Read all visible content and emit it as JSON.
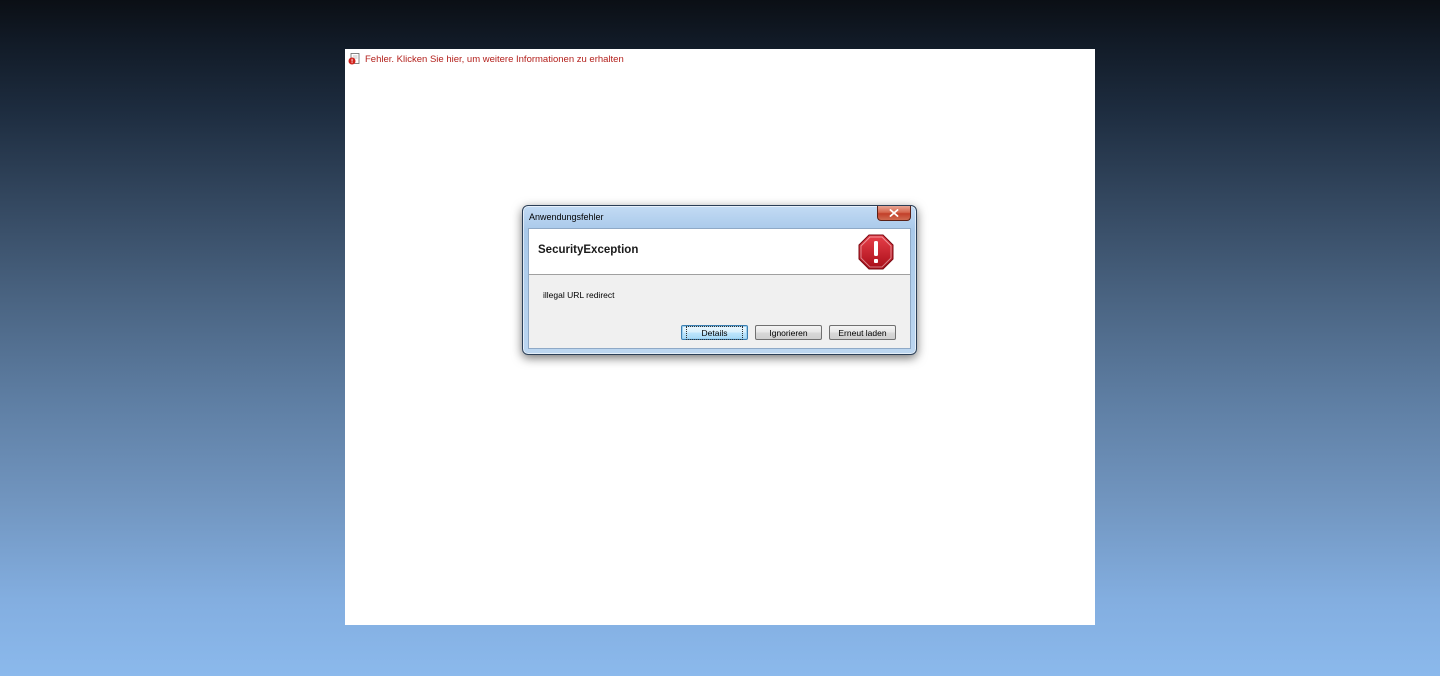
{
  "plugin": {
    "error_link": "Fehler. Klicken Sie hier, um weitere Informationen zu erhalten"
  },
  "dialog": {
    "title": "Anwendungsfehler",
    "header_title": "SecurityException",
    "message": "illegal URL redirect",
    "buttons": {
      "details": "Details",
      "ignore": "Ignorieren",
      "reload": "Erneut laden"
    },
    "icons": {
      "close": "close-icon",
      "error": "stop-error-icon"
    }
  },
  "colors": {
    "error_text": "#b3201c",
    "stop_icon": "#c8102e",
    "close_button": "#c2402a"
  }
}
